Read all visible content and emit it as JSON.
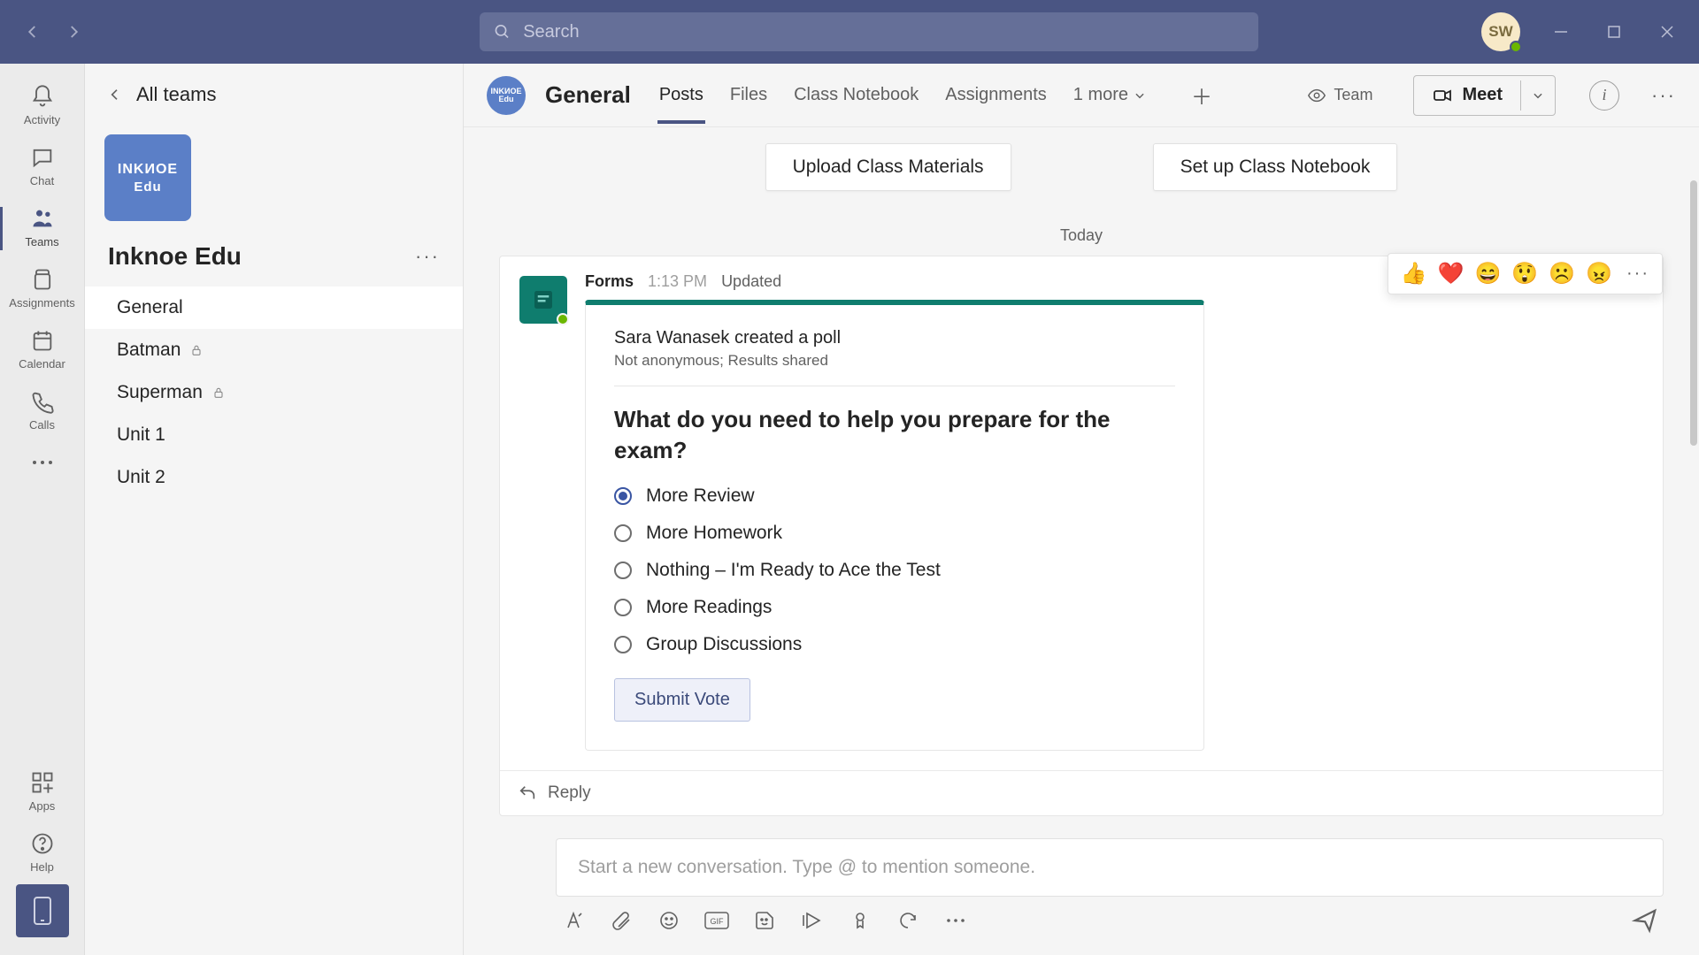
{
  "search": {
    "placeholder": "Search"
  },
  "user": {
    "initials": "SW"
  },
  "rail": {
    "items": [
      {
        "label": "Activity"
      },
      {
        "label": "Chat"
      },
      {
        "label": "Teams"
      },
      {
        "label": "Assignments"
      },
      {
        "label": "Calendar"
      },
      {
        "label": "Calls"
      }
    ],
    "apps": "Apps",
    "help": "Help"
  },
  "channelPanel": {
    "back": "All teams",
    "logoTop": "INKИOE",
    "logoBottom": "Edu",
    "teamName": "Inknoe Edu",
    "channels": [
      {
        "name": "General",
        "locked": false,
        "selected": true
      },
      {
        "name": "Batman",
        "locked": true,
        "selected": false
      },
      {
        "name": "Superman",
        "locked": true,
        "selected": false
      },
      {
        "name": "Unit 1",
        "locked": false,
        "selected": false
      },
      {
        "name": "Unit 2",
        "locked": false,
        "selected": false
      }
    ]
  },
  "header": {
    "channel": "General",
    "tabs": [
      "Posts",
      "Files",
      "Class Notebook",
      "Assignments"
    ],
    "moreTabs": "1 more",
    "teamVis": "Team",
    "meet": "Meet"
  },
  "actions": {
    "upload": "Upload Class Materials",
    "notebook": "Set up Class Notebook"
  },
  "dateSep": "Today",
  "message": {
    "app": "Forms",
    "time": "1:13 PM",
    "updated": "Updated",
    "pollCreated": "Sara Wanasek created a poll",
    "pollSub": "Not anonymous; Results shared",
    "question": "What do you need to help you prepare for the exam?",
    "options": [
      "More Review",
      "More Homework",
      "Nothing – I'm Ready to Ace the Test",
      "More Readings",
      "Group Discussions"
    ],
    "selectedIndex": 0,
    "submit": "Submit Vote",
    "reply": "Reply"
  },
  "reactions": [
    "👍",
    "❤️",
    "😄",
    "😲",
    "☹️",
    "😠"
  ],
  "composer": {
    "placeholder": "Start a new conversation. Type @ to mention someone."
  }
}
